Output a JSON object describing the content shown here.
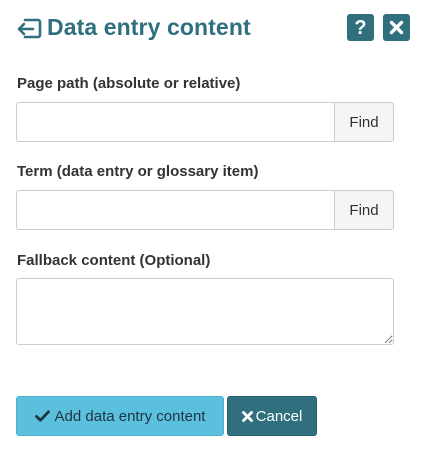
{
  "dialog": {
    "title": "Data entry content",
    "back_icon": "return-arrow-icon",
    "help_button_label": "?",
    "close_icon": "close-icon"
  },
  "fields": {
    "page_path": {
      "label": "Page path (absolute or relative)",
      "value": "",
      "find_label": "Find"
    },
    "term": {
      "label": "Term (data entry or glossary item)",
      "value": "",
      "find_label": "Find"
    },
    "fallback": {
      "label": "Fallback content (Optional)",
      "value": ""
    }
  },
  "buttons": {
    "add_label": "Add data entry content",
    "add_icon": "checkmark-icon",
    "cancel_label": "Cancel",
    "cancel_icon": "x-icon"
  },
  "colors": {
    "accent": "#2f6f7e",
    "primary_button": "#5bc0de",
    "find_button_bg": "#f5f5f5",
    "border": "#cccccc"
  }
}
